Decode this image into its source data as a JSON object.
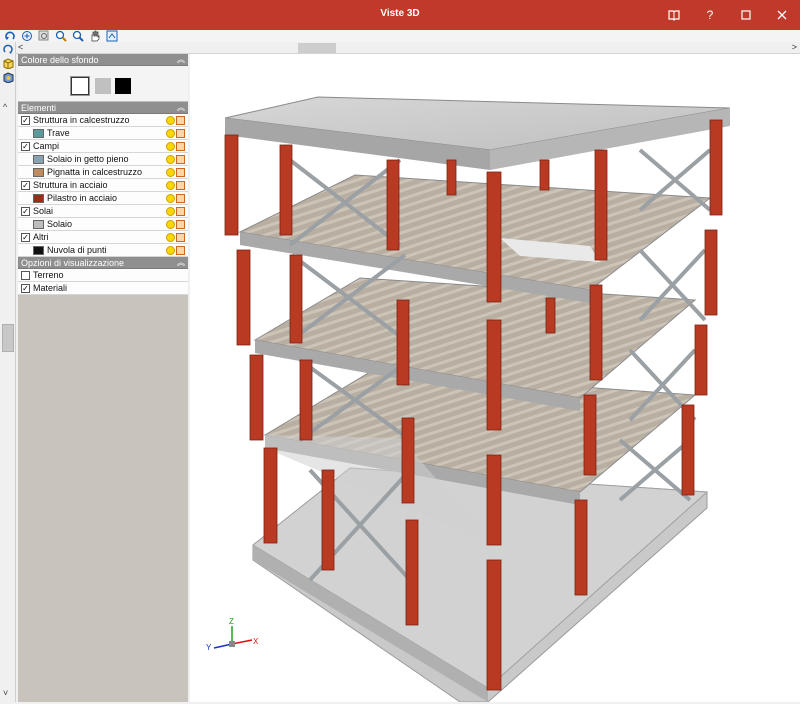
{
  "window": {
    "title": "Viste 3D",
    "controls": [
      "book-icon",
      "help-icon",
      "minimize-icon",
      "close-icon"
    ],
    "help_label": "?",
    "accent": "#c0392b"
  },
  "toolbar": {
    "tools": [
      "rotate-icon",
      "zoom-extents-icon",
      "zoom-window-icon",
      "zoom-dynamic-icon",
      "zoom-icon",
      "pan-icon",
      "select-view-icon"
    ]
  },
  "left_tools": [
    "orbit-icon",
    "views-icon",
    "render-icon"
  ],
  "panel": {
    "background": {
      "title": "Colore dello sfondo",
      "swatches": [
        "#ffffff",
        "#c0c0c0",
        "#000000"
      ]
    },
    "elements": {
      "title": "Elementi",
      "rows": [
        {
          "label": "Struttura in calcestruzzo",
          "checked": true,
          "sub": false,
          "color": ""
        },
        {
          "label": "Trave",
          "checked": false,
          "sub": true,
          "color": "#5a9a9a"
        },
        {
          "label": "Campi",
          "checked": true,
          "sub": false,
          "color": ""
        },
        {
          "label": "Solaio in getto pieno",
          "checked": false,
          "sub": true,
          "color": "#8ba3b0"
        },
        {
          "label": "Pignatta in calcestruzzo",
          "checked": false,
          "sub": true,
          "color": "#c08a5a"
        },
        {
          "label": "Struttura in acciaio",
          "checked": true,
          "sub": false,
          "color": ""
        },
        {
          "label": "Pilastro in acciaio",
          "checked": false,
          "sub": true,
          "color": "#a02a1a"
        },
        {
          "label": "Solai",
          "checked": true,
          "sub": false,
          "color": ""
        },
        {
          "label": "Solaio",
          "checked": false,
          "sub": true,
          "color": "#bdbdbd"
        },
        {
          "label": "Altri",
          "checked": true,
          "sub": false,
          "color": ""
        },
        {
          "label": "Nuvola di punti",
          "checked": false,
          "sub": true,
          "color": "#111111"
        }
      ]
    },
    "display": {
      "title": "Opzioni di visualizzazione",
      "rows": [
        {
          "label": "Terreno",
          "checked": false
        },
        {
          "label": "Materiali",
          "checked": true
        }
      ]
    }
  },
  "axes": {
    "x": "X",
    "y": "Y",
    "z": "Z"
  },
  "colors": {
    "column": "#b83a22",
    "slab": "#c6c6c6",
    "brace": "#a8a8a8"
  }
}
